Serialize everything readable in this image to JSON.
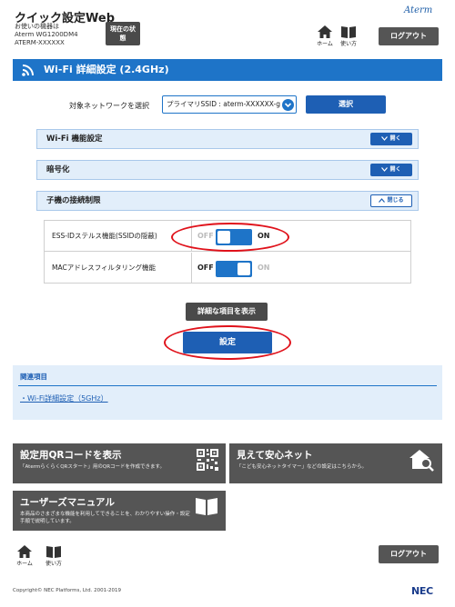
{
  "header": {
    "app_title": "クイック設定Web",
    "device_lines": [
      "お使いの機器は",
      "Aterm WG1200DM4",
      "ATERM-XXXXXX"
    ],
    "status_button": "現在の状態",
    "brand": "Aterm",
    "home_label": "ホーム",
    "manual_label": "使い方",
    "logout_label": "ログアウト"
  },
  "page": {
    "title": "Wi-Fi 詳細設定 (2.4GHz)"
  },
  "network_select": {
    "label": "対象ネットワークを選択",
    "value": "プライマリSSID : aterm-XXXXXX-g",
    "button_label": "選択"
  },
  "sections": [
    {
      "title": "Wi-Fi 機能設定",
      "button": "開く",
      "state": "collapsed"
    },
    {
      "title": "暗号化",
      "button": "開く",
      "state": "collapsed"
    },
    {
      "title": "子機の接続制限",
      "button": "閉じる",
      "state": "expanded"
    }
  ],
  "settings": [
    {
      "label": "ESS-IDステルス機能(SSIDの隠蔽)",
      "off_label": "OFF",
      "on_label": "ON",
      "value": "ON"
    },
    {
      "label": "MACアドレスフィルタリング機能",
      "off_label": "OFF",
      "on_label": "ON",
      "value": "OFF"
    }
  ],
  "buttons": {
    "show_details": "詳細な項目を表示",
    "apply": "設定"
  },
  "related": {
    "title": "関連項目",
    "links": [
      "Wi-Fi詳細設定（5GHz）"
    ]
  },
  "cards": [
    {
      "title": "設定用QRコードを表示",
      "subtitle": "「AtermらくらくQRスタート」用のQRコードを作成できます。",
      "icon": "qr-code-icon"
    },
    {
      "title": "見えて安心ネット",
      "subtitle": "「こども安心ネットタイマー」などの設定はこちらから。",
      "icon": "home-search-icon"
    },
    {
      "title": "ユーザーズマニュアル",
      "subtitle": "本商品のさまざまな機能を利用してできることを、わかりやすい操作・設定手順で説明しています。",
      "icon": "book-icon"
    }
  ],
  "footer": {
    "home_label": "ホーム",
    "manual_label": "使い方",
    "logout_label": "ログアウト",
    "copyright": "Copyright© NEC Platforms, Ltd. 2001-2019",
    "vendor": "NEC"
  },
  "colors": {
    "accent": "#1e74c8",
    "button_blue": "#1e5fb4",
    "button_dark": "#4a4a4a",
    "panel_bg": "#e2eefa",
    "highlight_red": "#e0121b"
  }
}
